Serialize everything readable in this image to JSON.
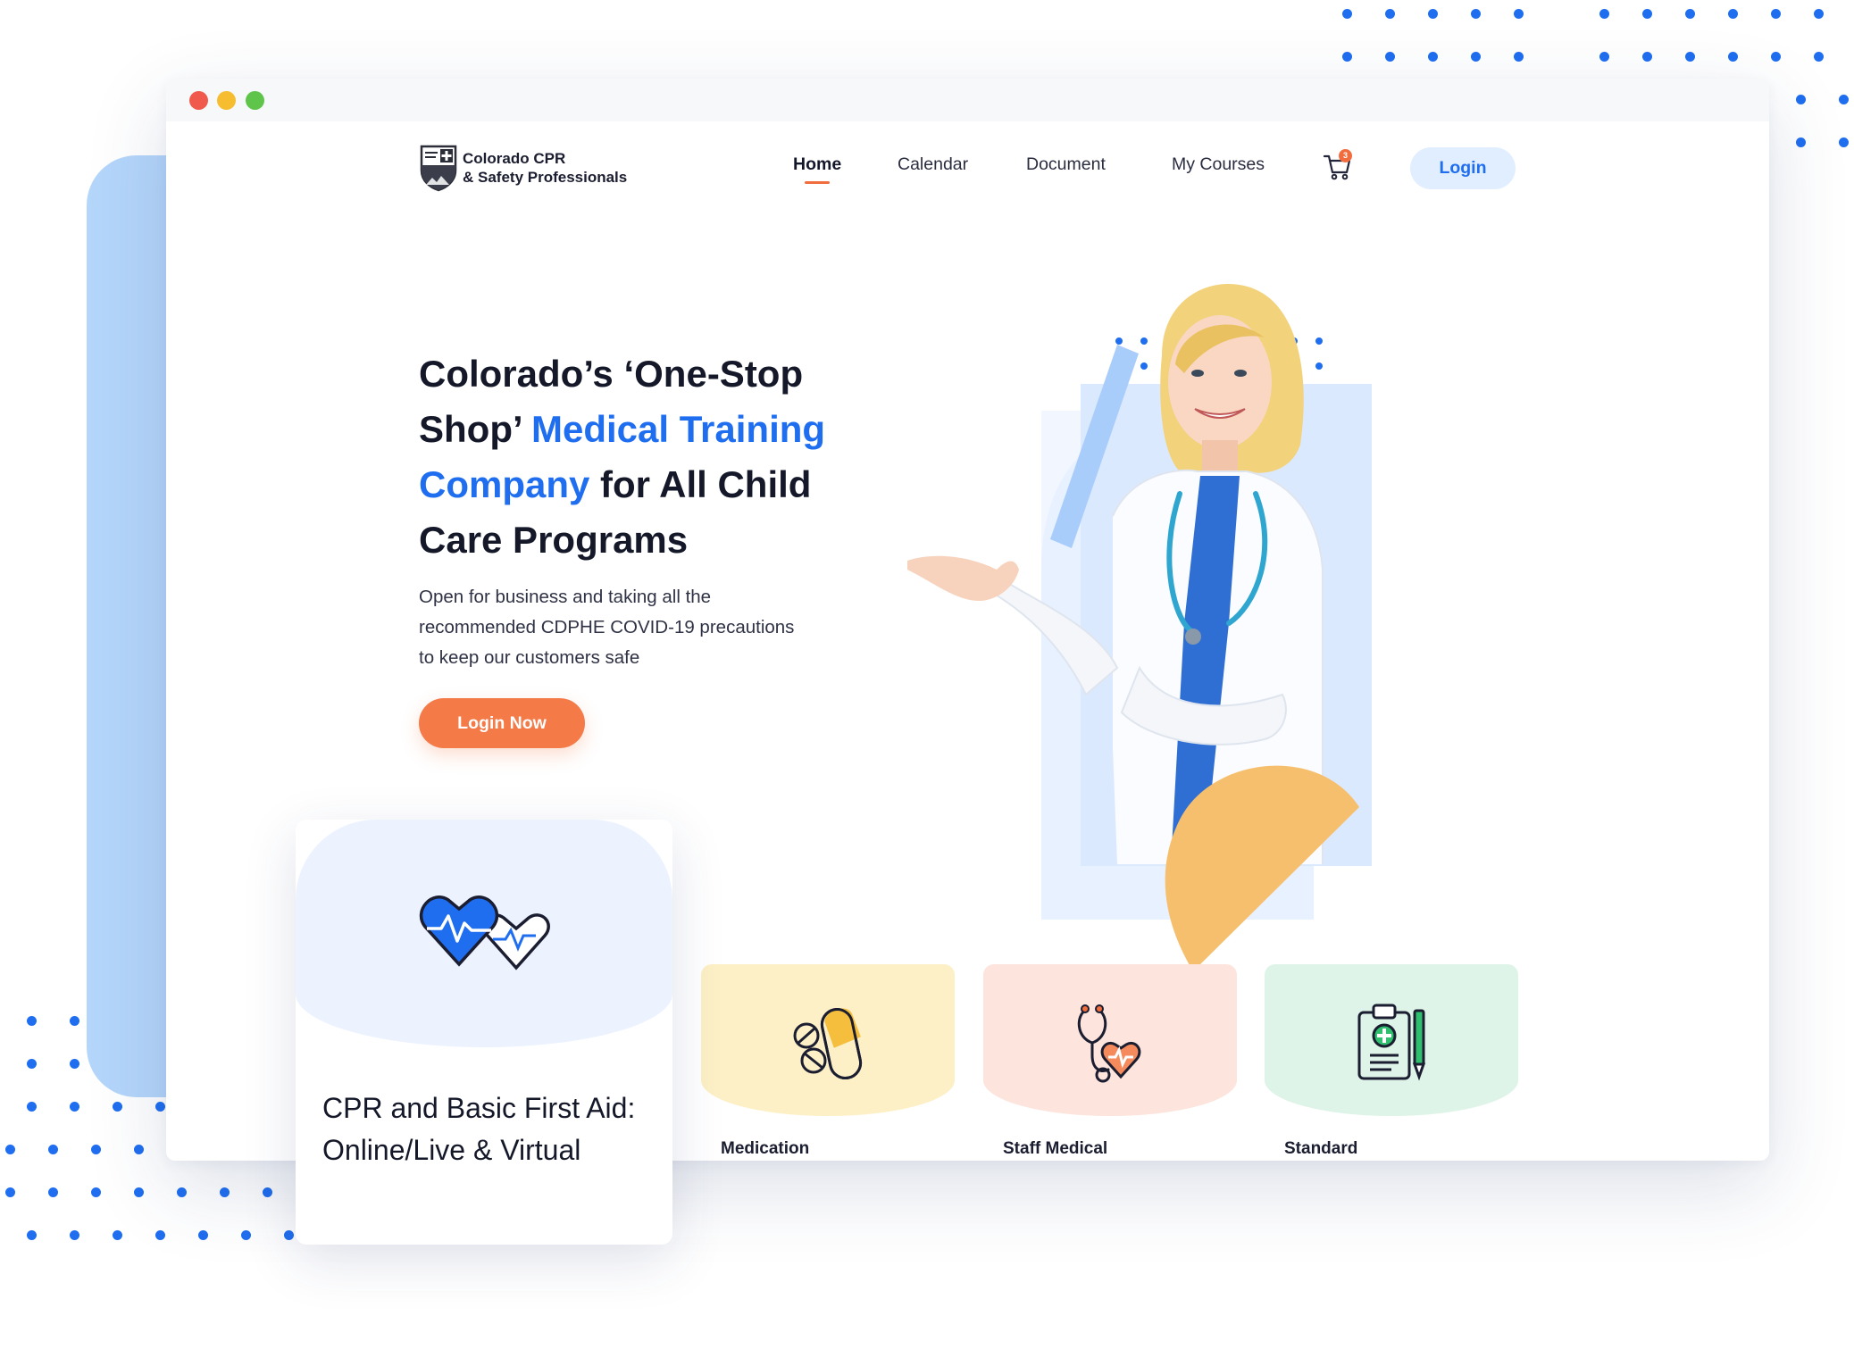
{
  "window": {
    "traffic_lights": [
      "#ef5a4c",
      "#f6bd30",
      "#5fc54a"
    ]
  },
  "brand": {
    "name_line1": "Colorado CPR",
    "name_line2": "& Safety Professionals",
    "logo_icon": "shield-cross-icon"
  },
  "nav": {
    "items": [
      {
        "label": "Home",
        "active": true
      },
      {
        "label": "Calendar",
        "active": false
      },
      {
        "label": "Document",
        "active": false
      },
      {
        "label": "My Courses",
        "active": false
      }
    ],
    "cart_icon": "cart-icon",
    "cart_count": "3",
    "login_label": "Login"
  },
  "hero": {
    "title_part1": "Colorado’s ‘One-Stop Shop’ ",
    "title_accent": "Medical Training Company",
    "title_part2": " for All Child Care Programs",
    "subtitle": "Open for business and taking all the recommended CDPHE COVID-19 precautions to keep our customers safe",
    "cta_label": "Login Now"
  },
  "feature_card": {
    "icon": "hearts-heartbeat-icon",
    "title": "CPR and Basic First Aid: Online/Live & Virtual"
  },
  "course_cards": [
    {
      "label": "Medication",
      "icon": "pills-icon",
      "bg": "#fdf0c6"
    },
    {
      "label": "Staff Medical",
      "icon": "stethoscope-heart-icon",
      "bg": "#fde4dc"
    },
    {
      "label": "Standard",
      "icon": "clipboard-pen-icon",
      "bg": "#dff4e8"
    }
  ],
  "colors": {
    "accent_blue": "#1f6ef0",
    "accent_orange": "#f47a48",
    "text_dark": "#141829"
  }
}
